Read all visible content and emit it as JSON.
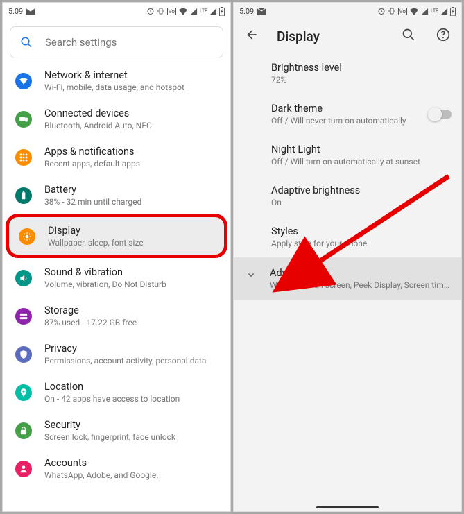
{
  "status": {
    "time": "5:09",
    "vo_label": "Vo",
    "lte_label": "LTE"
  },
  "left": {
    "search_placeholder": "Search settings",
    "items": [
      {
        "title": "Network & internet",
        "sub": "Wi-Fi, mobile, data usage, and hotspot",
        "color": "#1a73e8",
        "icon": "wifi"
      },
      {
        "title": "Connected devices",
        "sub": "Bluetooth, Android Auto, NFC",
        "color": "#43a047",
        "icon": "devices"
      },
      {
        "title": "Apps & notifications",
        "sub": "Recent apps, default apps",
        "color": "#fb8c00",
        "icon": "apps"
      },
      {
        "title": "Battery",
        "sub": "38% - 32 min until charged",
        "color": "#00796b",
        "icon": "battery"
      },
      {
        "title": "Display",
        "sub": "Wallpaper, sleep, font size",
        "color": "#fb8c00",
        "icon": "brightness",
        "highlight": true
      },
      {
        "title": "Sound & vibration",
        "sub": "Volume, vibration, Do Not Disturb",
        "color": "#009688",
        "icon": "volume"
      },
      {
        "title": "Storage",
        "sub": "87% used - 17.22 GB free",
        "color": "#8e24aa",
        "icon": "storage"
      },
      {
        "title": "Privacy",
        "sub": "Permissions, account activity, personal data",
        "color": "#5c6bc0",
        "icon": "privacy"
      },
      {
        "title": "Location",
        "sub": "On - 42 apps have access to location",
        "color": "#00bfa5",
        "icon": "location"
      },
      {
        "title": "Security",
        "sub": "Screen lock, fingerprint, face unlock",
        "color": "#43a047",
        "icon": "lock"
      },
      {
        "title": "Accounts",
        "sub": "WhatsApp, Adobe, and Google.",
        "color": "#e91e63",
        "icon": "account",
        "underline": true
      }
    ]
  },
  "right": {
    "title": "Display",
    "items": [
      {
        "title": "Brightness level",
        "sub": "72%"
      },
      {
        "title": "Dark theme",
        "sub": "Off / Will never turn on automatically",
        "toggle": "off"
      },
      {
        "title": "Night Light",
        "sub": "Off / Will turn on automatically at sunset"
      },
      {
        "title": "Adaptive brightness",
        "sub": "On"
      },
      {
        "title": "Styles",
        "sub": "Apply style for your phone"
      }
    ],
    "advanced": {
      "title": "Advanced",
      "sub": "Wallpaper, Full screen, Peek Display, Screen timeo.."
    }
  }
}
